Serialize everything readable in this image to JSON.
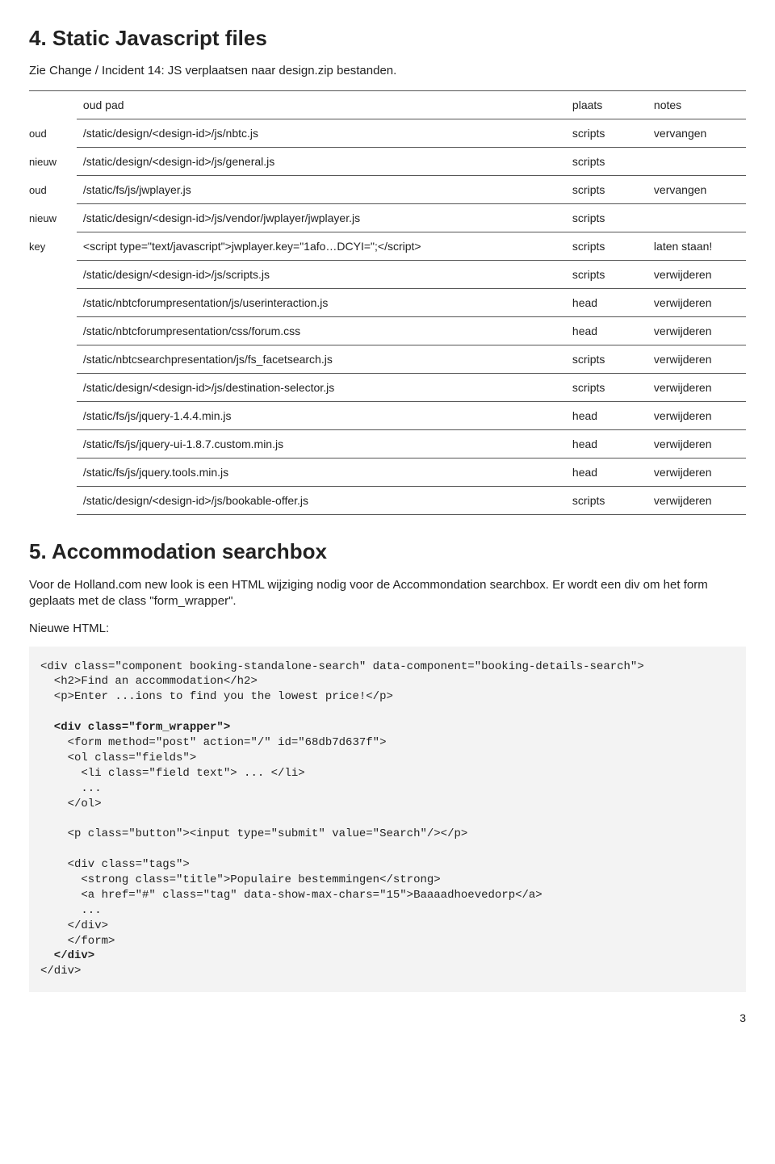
{
  "section4": {
    "title": "4.  Static Javascript files",
    "subtitle": "Zie Change / Incident 14: JS verplaatsen naar design.zip bestanden.",
    "headers": {
      "path": "oud pad",
      "place": "plaats",
      "notes": "notes"
    },
    "rows": [
      {
        "tag": "oud",
        "path": "/static/design/<design-id>/js/nbtc.js",
        "place": "scripts",
        "notes": "vervangen"
      },
      {
        "tag": "nieuw",
        "path": "/static/design/<design-id>/js/general.js",
        "place": "scripts",
        "notes": ""
      },
      {
        "tag": "oud",
        "path": "/static/fs/js/jwplayer.js",
        "place": "scripts",
        "notes": "vervangen"
      },
      {
        "tag": "nieuw",
        "path": "/static/design/<design-id>/js/vendor/jwplayer/jwplayer.js",
        "place": "scripts",
        "notes": ""
      },
      {
        "tag": "key",
        "path": "<script type=\"text/javascript\">jwplayer.key=\"1afo…DCYI=\";</script>",
        "place": "scripts",
        "notes": "laten staan!"
      },
      {
        "tag": "",
        "path": "/static/design/<design-id>/js/scripts.js",
        "place": "scripts",
        "notes": "verwijderen"
      },
      {
        "tag": "",
        "path": "/static/nbtcforumpresentation/js/userinteraction.js",
        "place": "head",
        "notes": "verwijderen"
      },
      {
        "tag": "",
        "path": "/static/nbtcforumpresentation/css/forum.css",
        "place": "head",
        "notes": "verwijderen"
      },
      {
        "tag": "",
        "path": "/static/nbtcsearchpresentation/js/fs_facetsearch.js",
        "place": "scripts",
        "notes": "verwijderen"
      },
      {
        "tag": "",
        "path": "/static/design/<design-id>/js/destination-selector.js",
        "place": "scripts",
        "notes": "verwijderen"
      },
      {
        "tag": "",
        "path": "/static/fs/js/jquery-1.4.4.min.js",
        "place": "head",
        "notes": "verwijderen"
      },
      {
        "tag": "",
        "path": "/static/fs/js/jquery-ui-1.8.7.custom.min.js",
        "place": "head",
        "notes": "verwijderen"
      },
      {
        "tag": "",
        "path": "/static/fs/js/jquery.tools.min.js",
        "place": "head",
        "notes": "verwijderen"
      },
      {
        "tag": "",
        "path": "/static/design/<design-id>/js/bookable-offer.js",
        "place": "scripts",
        "notes": "verwijderen"
      }
    ]
  },
  "section5": {
    "title": "5.  Accommodation searchbox",
    "intro": "Voor de Holland.com new look is een HTML wijziging nodig voor de Accommondation searchbox. Er wordt een div om het form geplaats met de class \"form_wrapper\".",
    "label": "Nieuwe HTML:",
    "code": {
      "l1": "<div class=\"component booking-standalone-search\" data-component=\"booking-details-search\">",
      "l2": "  <h2>Find an accommodation</h2>",
      "l3": "  <p>Enter ...ions to find you the lowest price!</p>",
      "l4": "",
      "l5": "  <div class=\"form_wrapper\">",
      "l6": "    <form method=\"post\" action=\"/\" id=\"68db7d637f\">",
      "l7": "    <ol class=\"fields\">",
      "l8": "      <li class=\"field text\"> ... </li>",
      "l9": "      ...",
      "l10": "    </ol>",
      "l11": "",
      "l12": "    <p class=\"button\"><input type=\"submit\" value=\"Search\"/></p>",
      "l13": "",
      "l14": "    <div class=\"tags\">",
      "l15": "      <strong class=\"title\">Populaire bestemmingen</strong>",
      "l16": "      <a href=\"#\" class=\"tag\" data-show-max-chars=\"15\">Baaaadhoevedorp</a>",
      "l17": "      ...",
      "l18": "    </div>",
      "l19": "    </form>",
      "l20": "  </div>",
      "l21": "</div>"
    }
  },
  "page_number": "3"
}
